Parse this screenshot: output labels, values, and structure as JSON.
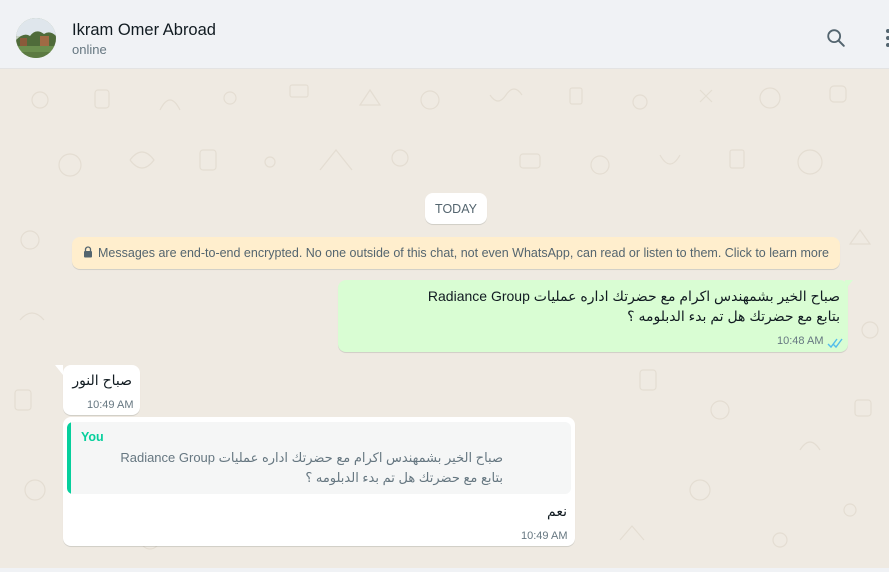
{
  "header": {
    "contact_name": "Ikram Omer Abroad",
    "status": "online",
    "avatar_icon": "avatar-photo",
    "search_icon": "search-icon",
    "menu_icon": "more-vertical-icon"
  },
  "chat": {
    "date_separator": "TODAY",
    "encryption_notice": "Messages are end-to-end encrypted. No one outside of this chat, not even WhatsApp, can read or listen to them. Click to learn more",
    "messages": [
      {
        "direction": "outgoing",
        "lines": [
          "صباح الخير بشمهندس اكرام مع حضرتك  اداره عمليات Radiance Group",
          "بتابع مع حضرتك هل تم بدء الدبلومه ؟"
        ],
        "time": "10:48 AM",
        "status_icon": "double-check-read-icon"
      },
      {
        "direction": "incoming",
        "lines": [
          "صباح النور"
        ],
        "time": "10:49 AM"
      },
      {
        "direction": "incoming",
        "quote": {
          "author": "You",
          "lines": [
            "صباح الخير بشمهندس اكرام مع حضرتك  اداره عمليات Radiance Group",
            "بتابع مع حضرتك هل تم بدء الدبلومه ؟"
          ]
        },
        "lines": [
          "نعم"
        ],
        "time": "10:49 AM"
      }
    ]
  },
  "colors": {
    "header_bg": "#f0f2f5",
    "chat_bg": "#efeae2",
    "outgoing_bubble": "#d9fdd3",
    "incoming_bubble": "#ffffff",
    "notice_bg": "#ffeecd",
    "accent": "#06cf9c",
    "read_ticks": "#53bdeb"
  }
}
